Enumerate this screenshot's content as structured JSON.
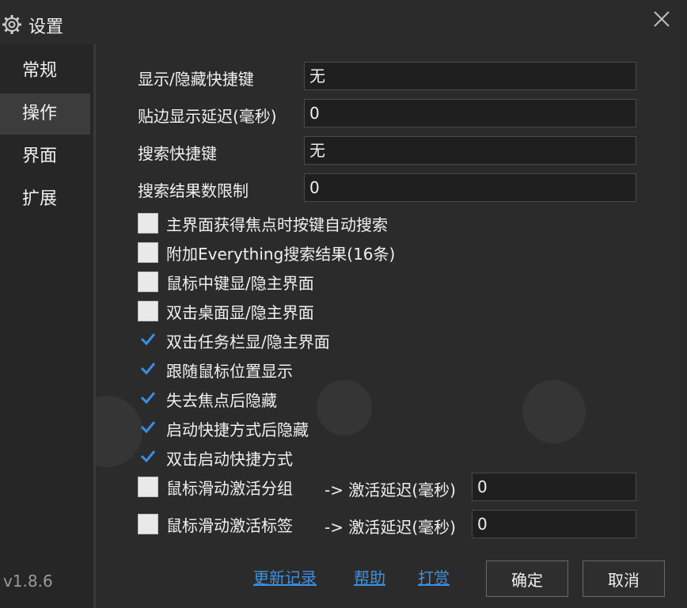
{
  "window": {
    "title": "设置",
    "close_icon": "close-icon",
    "settings_icon": "gear-icon"
  },
  "sidebar": {
    "items": [
      {
        "label": "常规",
        "active": false
      },
      {
        "label": "操作",
        "active": true
      },
      {
        "label": "界面",
        "active": false
      },
      {
        "label": "扩展",
        "active": false
      }
    ]
  },
  "fields": {
    "show_hide_hotkey": {
      "label": "显示/隐藏快捷键",
      "value": "无"
    },
    "edge_delay": {
      "label": "贴边显示延迟(毫秒)",
      "value": "0"
    },
    "search_hotkey": {
      "label": "搜索快捷键",
      "value": "无"
    },
    "result_limit": {
      "label": "搜索结果数限制",
      "value": "0"
    }
  },
  "options": [
    {
      "label": "主界面获得焦点时按键自动搜索",
      "checked": false
    },
    {
      "label": "附加Everything搜索结果(16条)",
      "checked": false
    },
    {
      "label": "鼠标中键显/隐主界面",
      "checked": false
    },
    {
      "label": "双击桌面显/隐主界面",
      "checked": false
    },
    {
      "label": "双击任务栏显/隐主界面",
      "checked": true
    },
    {
      "label": "跟随鼠标位置显示",
      "checked": true
    },
    {
      "label": "失去焦点后隐藏",
      "checked": true
    },
    {
      "label": "启动快捷方式后隐藏",
      "checked": true
    },
    {
      "label": "双击启动快捷方式",
      "checked": true
    }
  ],
  "hover_options": [
    {
      "label": "鼠标滑动激活分组",
      "checked": false,
      "delay_label": "-> 激活延迟(毫秒)",
      "delay_value": "0"
    },
    {
      "label": "鼠标滑动激活标签",
      "checked": false,
      "delay_label": "-> 激活延迟(毫秒)",
      "delay_value": "0"
    }
  ],
  "footer": {
    "version": "v1.8.6",
    "changelog_link": "更新记录",
    "help_link": "帮助",
    "donate_link": "打赏",
    "ok_label": "确定",
    "cancel_label": "取消"
  },
  "colors": {
    "accent_check": "#3a8ee6",
    "link": "#3f8fe0",
    "background": "#2b2b2b"
  }
}
